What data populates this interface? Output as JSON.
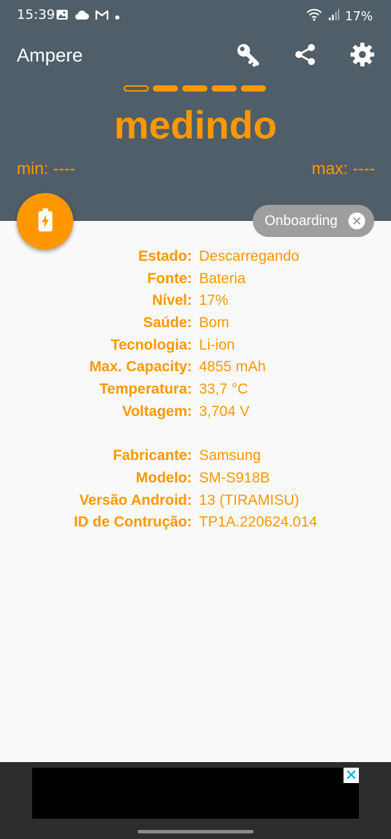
{
  "status_bar": {
    "time": "15:39",
    "battery_percent": "17%",
    "left_icons": [
      "image-icon",
      "cloud-icon",
      "gmail-icon",
      "dot-icon"
    ],
    "right_icons": [
      "wifi-icon",
      "signal-icon"
    ]
  },
  "app_bar": {
    "title": "Ampere",
    "actions": [
      "key-icon",
      "share-icon",
      "settings-icon"
    ]
  },
  "measure": {
    "progress_dashes_filled": 4,
    "progress_dashes_total": 5,
    "status_text": "medindo",
    "min_label": "min: ----",
    "max_label": "max: ----"
  },
  "fab": {
    "icon": "battery-charging-icon"
  },
  "chip": {
    "label": "Onboarding",
    "close_icon": "close-icon"
  },
  "info_section_1": [
    {
      "key": "Estado:",
      "value": "Descarregando"
    },
    {
      "key": "Fonte:",
      "value": "Bateria"
    },
    {
      "key": "Nível:",
      "value": "17%"
    },
    {
      "key": "Saúde:",
      "value": "Bom"
    },
    {
      "key": "Tecnologia:",
      "value": "Li-ion"
    },
    {
      "key": "Max. Capacity:",
      "value": "4855 mAh"
    },
    {
      "key": "Temperatura:",
      "value": "33,7 °C"
    },
    {
      "key": "Voltagem:",
      "value": "3,704 V"
    }
  ],
  "info_section_2": [
    {
      "key": "Fabricante:",
      "value": "Samsung"
    },
    {
      "key": "Modelo:",
      "value": "SM-S918B"
    },
    {
      "key": "Versão Android:",
      "value": "13 (TIRAMISU)"
    },
    {
      "key": "ID de Contrução:",
      "value": "TP1A.220624.014"
    }
  ],
  "ad": {
    "close_icon": "close-icon"
  },
  "colors": {
    "accent": "#ff9800",
    "app_bar": "#4f5e68",
    "background": "#f9f9f9",
    "chip": "#9e9e9e",
    "ad_background": "#2d2d2d"
  }
}
